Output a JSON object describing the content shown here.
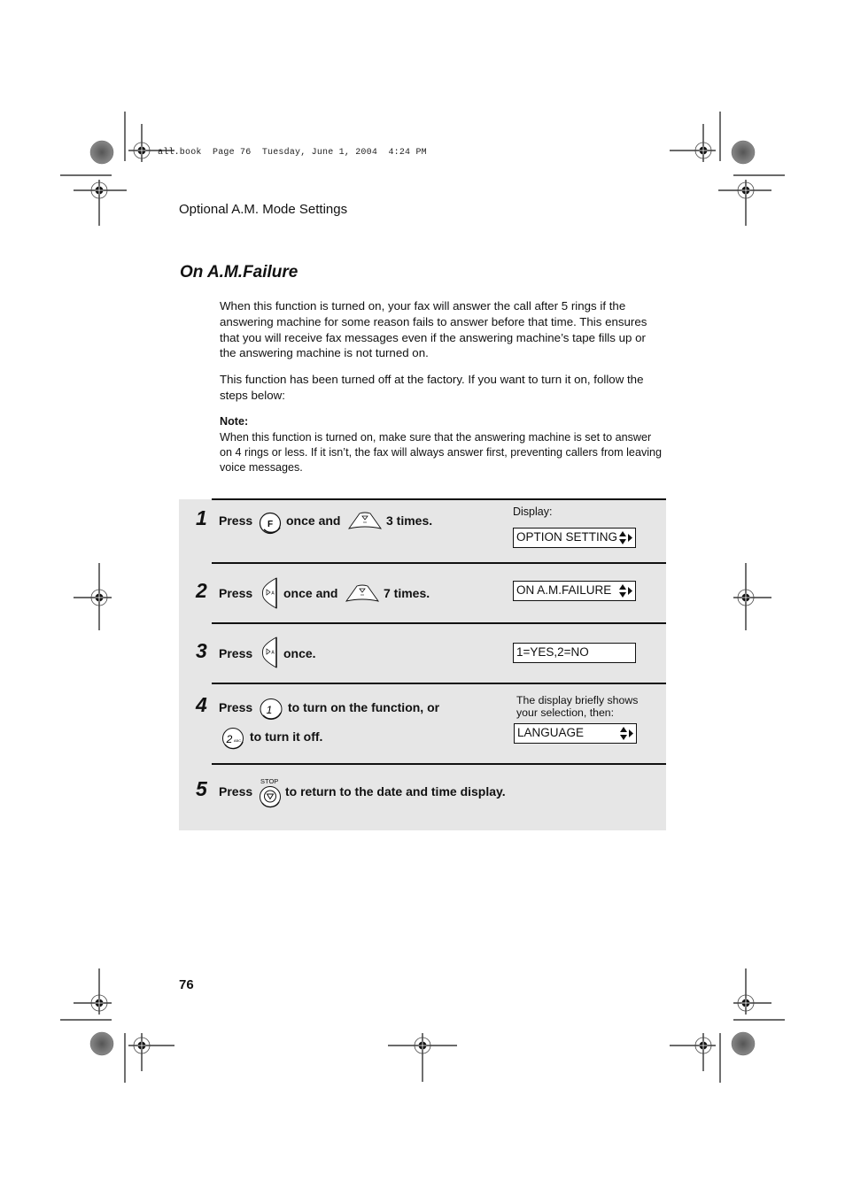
{
  "print_stamp": "all.book  Page 76  Tuesday, June 1, 2004  4:24 PM",
  "running_head": "Optional A.M. Mode Settings",
  "section_title": "On A.M.Failure",
  "paragraphs": [
    "When this function is turned on, your fax will answer the call after 5 rings if the answering machine for some reason fails to answer before that time. This ensures that you will receive fax messages even if the answering machine’s tape fills up or the answering machine is not turned on.",
    "This function has been turned off at the factory. If you want to turn it on, follow the steps below:"
  ],
  "note": {
    "label": "Note:",
    "text": "When this function is turned on, make sure that the answering machine is set to answer on 4 rings or less. If it isn’t, the fax will always answer first, preventing callers from leaving voice messages."
  },
  "steps": [
    {
      "number": "1",
      "parts": [
        "Press",
        "once and",
        "3 times."
      ],
      "keys": [
        "function-key-F",
        "down-arrow-key"
      ],
      "key_labels": {
        "F": "F"
      },
      "display_label": "Display:",
      "display": "OPTION SETTING",
      "display_arrows": true
    },
    {
      "number": "2",
      "parts": [
        "Press",
        "once and",
        "7 times."
      ],
      "keys": [
        "right-arrow-key",
        "down-arrow-key"
      ],
      "display": "ON A.M.FAILURE",
      "display_arrows": true
    },
    {
      "number": "3",
      "parts": [
        "Press",
        "once."
      ],
      "keys": [
        "right-arrow-key"
      ],
      "display": "1=YES,2=NO",
      "display_arrows": false
    },
    {
      "number": "4",
      "parts": [
        "Press",
        "to turn on the function, or",
        "to turn it off."
      ],
      "keys": [
        "number-key-1",
        "number-key-2"
      ],
      "key_labels": {
        "one": "1",
        "two": "2",
        "two_sub": "ABC"
      },
      "display_label": "The display briefly shows your selection, then:",
      "display": "LANGUAGE",
      "display_arrows": true
    },
    {
      "number": "5",
      "parts": [
        "Press",
        "to return to the date and time display."
      ],
      "keys": [
        "stop-key"
      ],
      "key_labels": {
        "stop": "STOP"
      }
    }
  ],
  "page_number": "76"
}
